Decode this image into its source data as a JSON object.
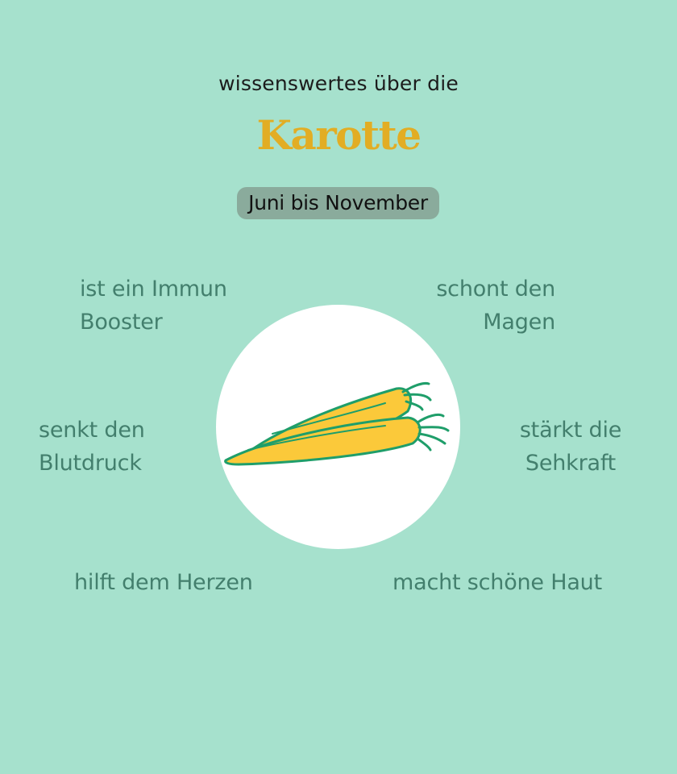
{
  "header": {
    "intro": "wissenswertes über die",
    "title": "Karotte",
    "season": "Juni bis November"
  },
  "facts": [
    "ist ein Immun\nBooster",
    "schont den\nMagen",
    "senkt den\nBlutdruck",
    "stärkt die\nSehkraft",
    "hilft dem Herzen",
    "macht schöne Haut"
  ],
  "colors": {
    "background": "#a6e1cd",
    "title": "#e2ad24",
    "fact_text": "#437f6d",
    "season_badge": "#8aab9c",
    "carrot_fill": "#fbc93a",
    "carrot_outline": "#1f9e6a"
  },
  "illustration": {
    "icon": "carrot-icon"
  }
}
